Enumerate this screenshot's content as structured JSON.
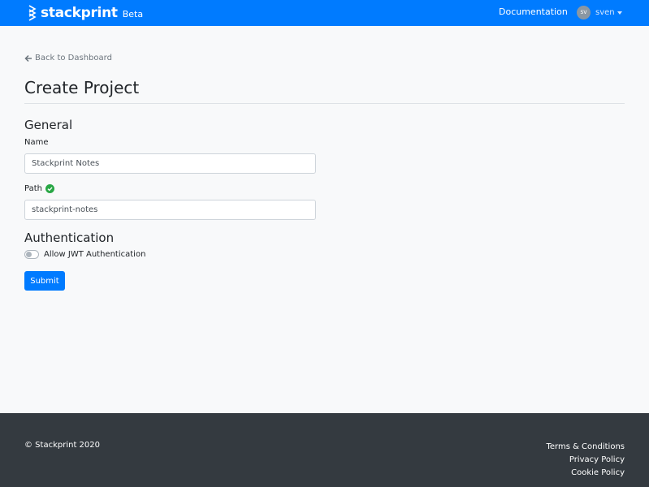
{
  "navbar": {
    "brand_name": "stackprint",
    "brand_badge": "Beta",
    "documentation_label": "Documentation",
    "user_initials": "SV",
    "user_name": "sven",
    "bg_color": "#007bff"
  },
  "back_link": {
    "icon": "arrow-left-icon",
    "label": "Back to Dashboard"
  },
  "page_title": "Create Project",
  "form": {
    "general_heading": "General",
    "name_label": "Name",
    "name_value": "Stackprint Notes",
    "path_label": "Path",
    "path_status_icon": "check-circle-icon",
    "path_value": "stackprint-notes",
    "auth_heading": "Authentication",
    "jwt_label": "Allow JWT Authentication",
    "jwt_enabled": false,
    "submit_label": "Submit"
  },
  "footer": {
    "copyright": "© Stackprint 2020",
    "links": [
      "Terms & Conditions",
      "Privacy Policy",
      "Cookie Policy"
    ],
    "bg_color": "#343a40"
  }
}
